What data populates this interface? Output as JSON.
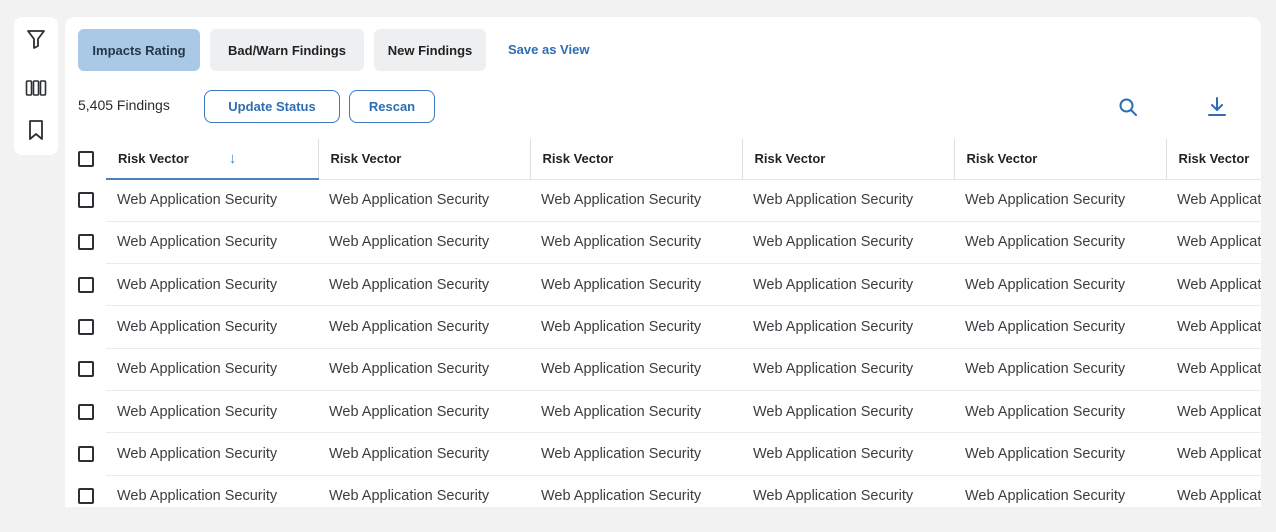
{
  "sidebar": {
    "items": [
      {
        "icon": "filter-icon"
      },
      {
        "icon": "columns-icon"
      },
      {
        "icon": "bookmark-icon"
      }
    ]
  },
  "tabs": [
    {
      "label": "Impacts Rating",
      "active": true
    },
    {
      "label": "Bad/Warn Findings",
      "active": false
    },
    {
      "label": "New Findings",
      "active": false
    }
  ],
  "save_view_label": "Save as View",
  "toolbar": {
    "count_label": "5,405 Findings",
    "update_status_label": "Update Status",
    "rescan_label": "Rescan",
    "search_icon": "search-icon",
    "download_icon": "download-icon"
  },
  "colors": {
    "active_tab": "#a9c9e6",
    "accent": "#2f6db1",
    "sort_indicator": "#4b7fc0"
  },
  "table": {
    "sort_column": 0,
    "sort_direction": "descending",
    "columns": [
      "Risk Vector",
      "Risk Vector",
      "Risk Vector",
      "Risk Vector",
      "Risk Vector",
      "Risk Vector"
    ],
    "rows": [
      [
        "Web Application Security",
        "Web Application Security",
        "Web Application Security",
        "Web Application Security",
        "Web Application Security",
        "Web Application Security"
      ],
      [
        "Web Application Security",
        "Web Application Security",
        "Web Application Security",
        "Web Application Security",
        "Web Application Security",
        "Web Application Security"
      ],
      [
        "Web Application Security",
        "Web Application Security",
        "Web Application Security",
        "Web Application Security",
        "Web Application Security",
        "Web Application Security"
      ],
      [
        "Web Application Security",
        "Web Application Security",
        "Web Application Security",
        "Web Application Security",
        "Web Application Security",
        "Web Application Security"
      ],
      [
        "Web Application Security",
        "Web Application Security",
        "Web Application Security",
        "Web Application Security",
        "Web Application Security",
        "Web Application Security"
      ],
      [
        "Web Application Security",
        "Web Application Security",
        "Web Application Security",
        "Web Application Security",
        "Web Application Security",
        "Web Application Security"
      ],
      [
        "Web Application Security",
        "Web Application Security",
        "Web Application Security",
        "Web Application Security",
        "Web Application Security",
        "Web Application Security"
      ],
      [
        "Web Application Security",
        "Web Application Security",
        "Web Application Security",
        "Web Application Security",
        "Web Application Security",
        "Web Application Security"
      ]
    ]
  }
}
